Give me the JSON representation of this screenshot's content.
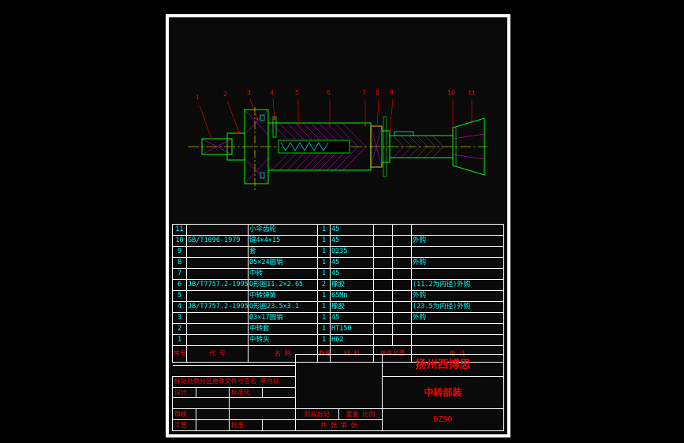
{
  "refs": [
    "1",
    "2",
    "3",
    "4",
    "5",
    "6",
    "7",
    "8",
    "9",
    "10",
    "11"
  ],
  "bom_header": {
    "idx": "序号",
    "code": "代  号",
    "name": "名    称",
    "qty": "数量",
    "material": "材    料",
    "single_wt": "单件总重",
    "note": "备    注"
  },
  "bom_rows": [
    {
      "idx": "11",
      "code": "",
      "name": "小伞齿轮",
      "qty": "1",
      "mat": "45",
      "wt1": "",
      "wt2": "",
      "note": ""
    },
    {
      "idx": "10",
      "code": "GB/T1096-1979",
      "name": "键4×4×15",
      "qty": "1",
      "mat": "45",
      "wt1": "",
      "wt2": "",
      "note": "外购"
    },
    {
      "idx": "9",
      "code": "",
      "name": "套",
      "qty": "1",
      "mat": "Q235",
      "wt1": "",
      "wt2": "",
      "note": ""
    },
    {
      "idx": "8",
      "code": "",
      "name": "Ø5×24圆销",
      "qty": "1",
      "mat": "45",
      "wt1": "",
      "wt2": "",
      "note": "外购"
    },
    {
      "idx": "7",
      "code": "",
      "name": "中转",
      "qty": "1",
      "mat": "45",
      "wt1": "",
      "wt2": "",
      "note": ""
    },
    {
      "idx": "6",
      "code": "JB/T7757.2-1995",
      "name": "O形圈11.2×2.65",
      "qty": "2",
      "mat": "橡胶",
      "wt1": "",
      "wt2": "",
      "note": "(11.2为内径)外购"
    },
    {
      "idx": "5",
      "code": "",
      "name": "中转弹簧",
      "qty": "1",
      "mat": "65Mn",
      "wt1": "",
      "wt2": "",
      "note": "外购"
    },
    {
      "idx": "4",
      "code": "JB/T7757.2-1995",
      "name": "O形圈23.5×3.1",
      "qty": "1",
      "mat": "橡胶",
      "wt1": "",
      "wt2": "",
      "note": "(23.5为内径)外购"
    },
    {
      "idx": "3",
      "code": "",
      "name": "Ø3×17圆销",
      "qty": "1",
      "mat": "45",
      "wt1": "",
      "wt2": "",
      "note": "外购"
    },
    {
      "idx": "2",
      "code": "",
      "name": "中转套",
      "qty": "1",
      "mat": "HT150",
      "wt1": "",
      "wt2": "",
      "note": ""
    },
    {
      "idx": "1",
      "code": "",
      "name": "中转头",
      "qty": "1",
      "mat": "H62",
      "wt1": "",
      "wt2": "",
      "note": ""
    }
  ],
  "titleblock": {
    "company": "扬州西博思",
    "assembly": "中转部装",
    "drawing_no": "DZ90",
    "rev_hdr": "标记处数分区更改文件号签名 年月日",
    "design": "设计",
    "standard": "标准化",
    "stage_mark": "阶段标记",
    "weight": "重量",
    "scale": "比例",
    "review": "审核",
    "process": "工艺",
    "approve": "批准",
    "sheet": "共  张 第  张"
  }
}
